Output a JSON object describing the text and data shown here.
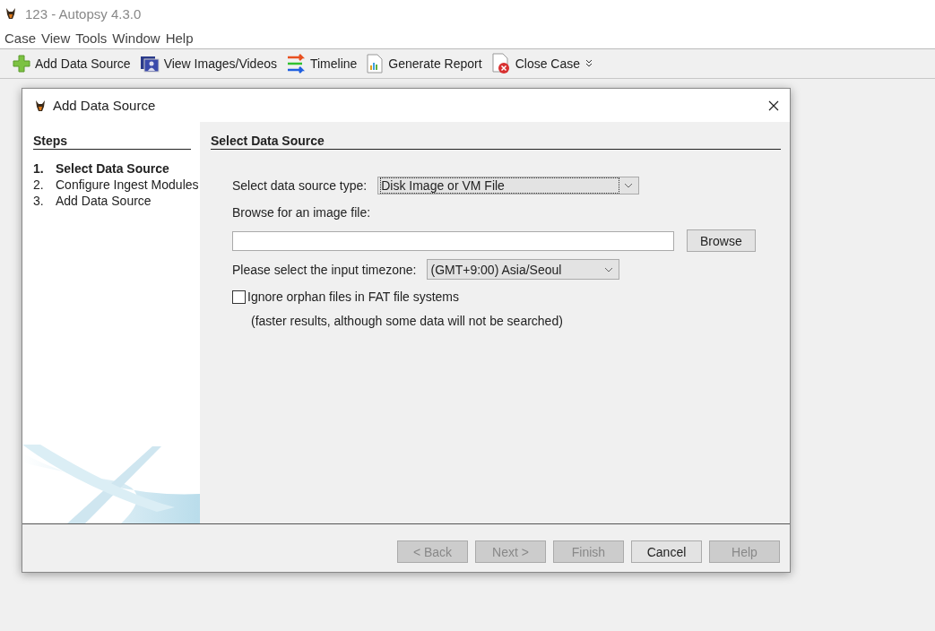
{
  "window": {
    "title": "123 - Autopsy 4.3.0"
  },
  "menu": [
    "Case",
    "View",
    "Tools",
    "Window",
    "Help"
  ],
  "toolbar": [
    {
      "label": "Add Data Source",
      "kind": "plus"
    },
    {
      "label": "View Images/Videos",
      "kind": "images"
    },
    {
      "label": "Timeline",
      "kind": "timeline"
    },
    {
      "label": "Generate Report",
      "kind": "report"
    },
    {
      "label": "Close Case",
      "kind": "close"
    }
  ],
  "dialog": {
    "title": "Add Data Source",
    "steps_heading": "Steps",
    "steps": [
      {
        "number": "1.",
        "label": "Select Data Source",
        "selected": true
      },
      {
        "number": "2.",
        "label": "Configure Ingest Modules",
        "selected": false
      },
      {
        "number": "3.",
        "label": "Add Data Source",
        "selected": false
      }
    ],
    "panel_heading": "Select Data Source",
    "type_label": "Select data source type:",
    "type_value": "Disk Image or VM File",
    "browse_label": "Browse for an image file:",
    "browse_button": "Browse",
    "timezone_label": "Please select the input timezone:",
    "timezone_value": "(GMT+9:00) Asia/Seoul",
    "orphan": {
      "label": "Ignore orphan files in FAT file systems",
      "checked": false
    },
    "orphan_note": "(faster results, although some data will not be searched)",
    "buttons": [
      {
        "label": "< Back",
        "disabled": true
      },
      {
        "label": "Next >",
        "disabled": true
      },
      {
        "label": "Finish",
        "disabled": true
      },
      {
        "label": "Cancel",
        "disabled": false
      },
      {
        "label": "Help",
        "disabled": true
      }
    ]
  }
}
